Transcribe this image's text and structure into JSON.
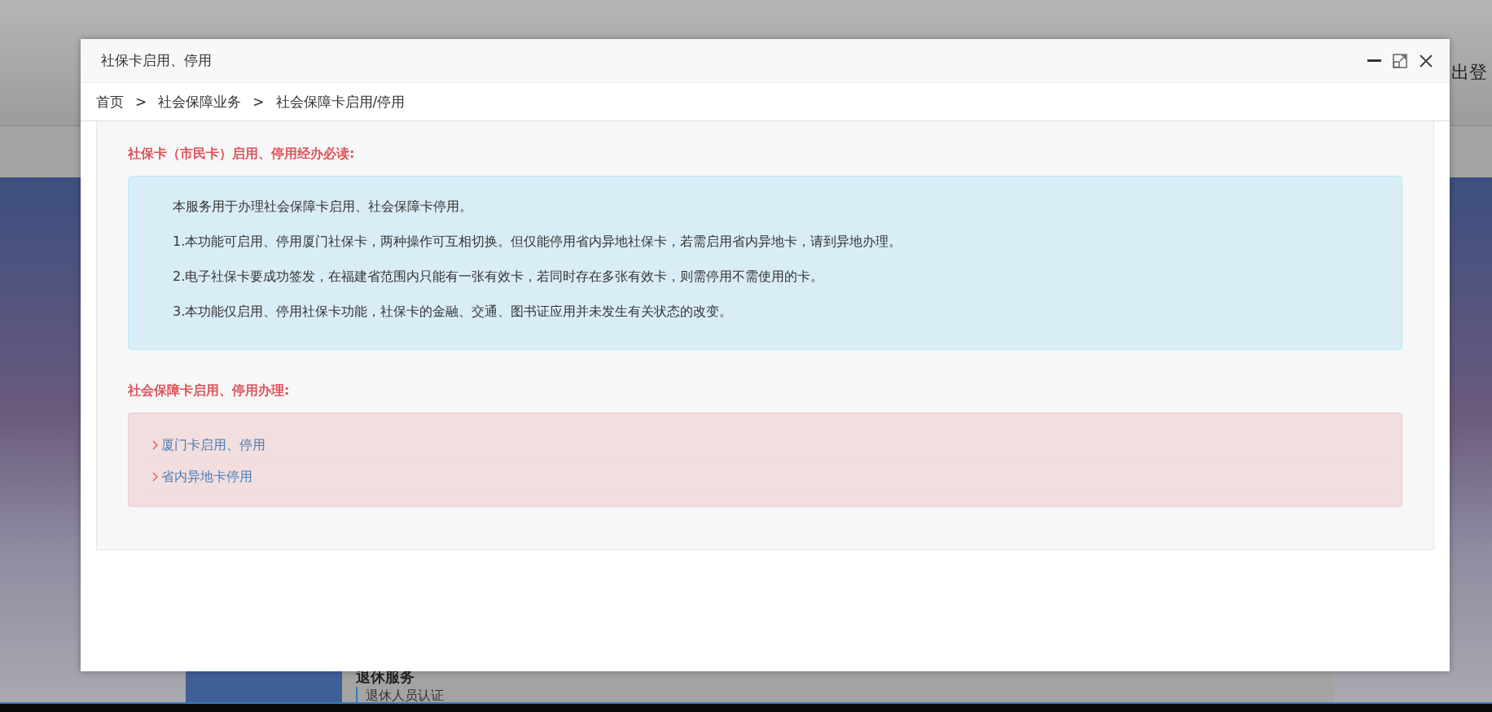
{
  "background": {
    "header_text": "出登",
    "service_title": "退休服务",
    "service_link": "退休人员认证"
  },
  "dialog": {
    "title": "社保卡启用、停用",
    "breadcrumb": [
      {
        "label": "首页",
        "separator": ">"
      },
      {
        "label": "社会保障业务",
        "separator": ">"
      },
      {
        "label": "社会保障卡启用/停用"
      }
    ],
    "notice": {
      "heading": "社保卡（市民卡）启用、停用经办必读:",
      "paragraphs": [
        "本服务用于办理社会保障卡启用、社会保障卡停用。",
        "1.本功能可启用、停用厦门社保卡，两种操作可互相切换。但仅能停用省内异地社保卡，若需启用省内异地卡，请到异地办理。",
        "2.电子社保卡要成功签发，在福建省范围内只能有一张有效卡，若同时存在多张有效卡，则需停用不需使用的卡。",
        "3.本功能仅启用、停用社保卡功能，社保卡的金融、交通、图书证应用并未发生有关状态的改变。"
      ]
    },
    "handling": {
      "heading": "社会保障卡启用、停用办理:",
      "links": [
        "厦门卡启用、停用",
        "省内异地卡停用"
      ]
    }
  }
}
